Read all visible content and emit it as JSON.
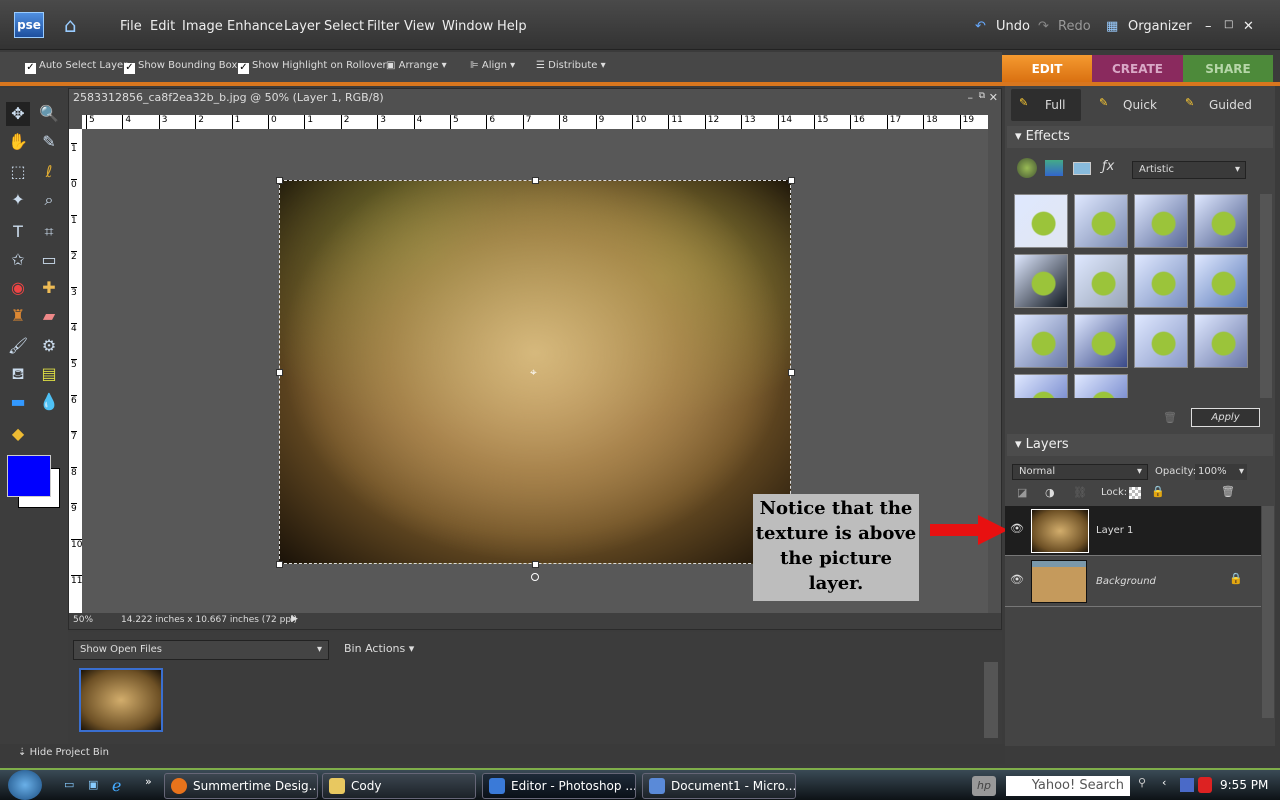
{
  "app": {
    "logo": "pse",
    "menu": [
      "File",
      "Edit",
      "Image",
      "Enhance",
      "Layer",
      "Select",
      "Filter",
      "View",
      "Window",
      "Help"
    ],
    "undo": "Undo",
    "redo": "Redo",
    "organizer": "Organizer"
  },
  "options": {
    "auto_select": "Auto Select Layer",
    "bounding_box": "Show Bounding Box",
    "highlight": "Show Highlight on Rollover",
    "arrange": "Arrange",
    "align": "Align",
    "distribute": "Distribute"
  },
  "mode_tabs": {
    "edit": "EDIT",
    "create": "CREATE",
    "share": "SHARE",
    "colors": {
      "edit": "#e5801c",
      "create": "#8a2a5e",
      "share": "#4d8a3a"
    }
  },
  "edit_modes": {
    "full": "Full",
    "quick": "Quick",
    "guided": "Guided"
  },
  "document": {
    "title": "2583312856_ca8f2ea32b_b.jpg @ 50% (Layer 1, RGB/8)",
    "zoom": "50%",
    "size": "14.222 inches x 10.667 inches (72 ppi)",
    "ruler_h": [
      "5",
      "4",
      "3",
      "2",
      "1",
      "0",
      "1",
      "2",
      "3",
      "4",
      "5",
      "6",
      "7",
      "8",
      "9",
      "10",
      "11",
      "12",
      "13",
      "14",
      "15",
      "16",
      "17",
      "18",
      "19"
    ],
    "ruler_v": [
      "1",
      "0",
      "1",
      "2",
      "3",
      "4",
      "5",
      "6",
      "7",
      "8",
      "9",
      "10",
      "11"
    ]
  },
  "annotation": "Notice that the texture is above the picture layer.",
  "colors": {
    "foreground": "#0000ff",
    "background": "#ffffff"
  },
  "effects": {
    "title": "Effects",
    "category": "Artistic",
    "apply": "Apply"
  },
  "layers": {
    "title": "Layers",
    "blend": "Normal",
    "opacity_label": "Opacity:",
    "opacity": "100%",
    "lock_label": "Lock:",
    "items": [
      {
        "name": "Layer 1",
        "selected": true
      },
      {
        "name": "Background",
        "locked": true
      }
    ]
  },
  "bin": {
    "show": "Show Open Files",
    "actions": "Bin Actions",
    "hide": "Hide Project Bin"
  },
  "taskbar": {
    "items": [
      "Summertime Desig...",
      "Cody",
      "Editor - Photoshop ...",
      "Document1 - Micro..."
    ],
    "search": "Yahoo! Search",
    "clock": "9:55 PM"
  }
}
